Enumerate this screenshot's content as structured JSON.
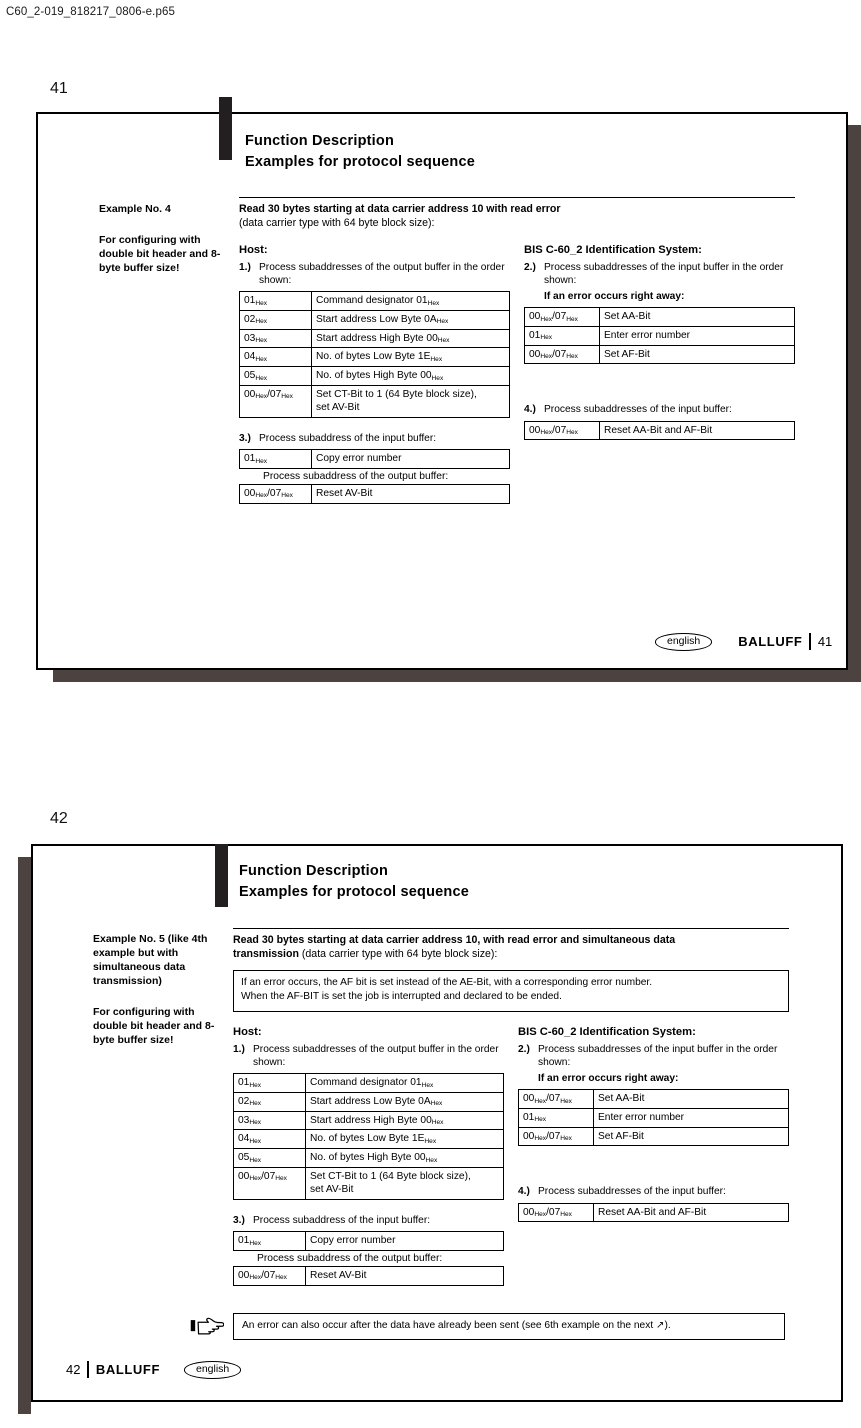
{
  "document": {
    "file_header": "C60_2-019_818217_0806-e.p65"
  },
  "common": {
    "title_line1": "Function Description",
    "title_line2": "Examples for protocol sequence",
    "host_heading": "Host:",
    "system_heading": "BIS C-60_2 Identification System:",
    "step1_no": "1.)",
    "step1_text": "Process subaddresses of the output buffer in the order shown:",
    "step2_no": "2.)",
    "step2_text": "Process subaddresses of the input buffer in the order shown:",
    "step2_sub": "If an error occurs right away:",
    "step3_no": "3.)",
    "step3_text": "Process subaddress of the input buffer:",
    "step3_sub": "Process subaddress of the output buffer:",
    "step4_no": "4.)",
    "step4_text": "Process subaddresses of the input buffer:",
    "english_label": "english",
    "brand": "BALLUFF",
    "output_buffer_table": [
      {
        "key": "01",
        "key_sub": "Hex",
        "key2": "",
        "value": "Command designator 01",
        "value_sub": "Hex",
        "value2": ""
      },
      {
        "key": "02",
        "key_sub": "Hex",
        "key2": "",
        "value": "Start address Low Byte 0A",
        "value_sub": "Hex",
        "value2": ""
      },
      {
        "key": "03",
        "key_sub": "Hex",
        "key2": "",
        "value": "Start address High Byte 00",
        "value_sub": "Hex",
        "value2": ""
      },
      {
        "key": "04",
        "key_sub": "Hex",
        "key2": "",
        "value": "No. of bytes Low Byte 1E",
        "value_sub": "Hex",
        "value2": ""
      },
      {
        "key": "05",
        "key_sub": "Hex",
        "key2": "",
        "value": "No. of bytes High Byte 00",
        "value_sub": "Hex",
        "value2": ""
      },
      {
        "key": "00",
        "key_sub": "Hex",
        "key2": "/07",
        "key_sub2": "Hex",
        "value": "Set CT-Bit to 1 (64 Byte block size),",
        "value_sub": "",
        "value2": "set AV-Bit"
      }
    ],
    "input_buffer_table": [
      {
        "key": "00",
        "key_sub": "Hex",
        "key2": "/07",
        "key_sub2": "Hex",
        "value": "Set AA-Bit"
      },
      {
        "key": "01",
        "key_sub": "Hex",
        "key2": "",
        "value": "Enter error number"
      },
      {
        "key": "00",
        "key_sub": "Hex",
        "key2": "/07",
        "key_sub2": "Hex",
        "value": "Set AF-Bit"
      }
    ],
    "step3_table1": [
      {
        "key": "01",
        "key_sub": "Hex",
        "key2": "",
        "value": "Copy error number"
      }
    ],
    "step3_table2": [
      {
        "key": "00",
        "key_sub": "Hex",
        "key2": "/07",
        "key_sub2": "Hex",
        "value": "Reset AV-Bit"
      }
    ],
    "step4_table": [
      {
        "key": "00",
        "key_sub": "Hex",
        "key2": "/07",
        "key_sub2": "Hex",
        "value": "Reset AA-Bit and AF-Bit"
      }
    ]
  },
  "page41": {
    "page_number": "41",
    "side_heads": [
      "Example No. 4",
      "For configuring with double bit header and 8-byte buffer size!"
    ],
    "lede_bold": "Read 30 bytes starting at data carrier address 10 with read error",
    "lede_plain": "(data carrier type with 64 byte block size):"
  },
  "page42": {
    "page_number": "42",
    "side_heads": [
      "Example No. 5 (like 4th example but with simultaneous data transmission)",
      "For configuring with double bit header and 8-byte buffer size!"
    ],
    "lede_bold1": "Read 30 bytes starting at data carrier address 10, with read error and simultaneous data",
    "lede_bold2": "transmission",
    "lede_plain": " (data carrier type with 64 byte block size):",
    "info_box_line1": "If an error occurs, the AF bit is set instead of the AE-Bit, with a corresponding error number.",
    "info_box_line2": "When the AF-BIT is set the job is interrupted and declared to be ended.",
    "note_text": "An error can also occur after the data have already been sent (see 6th example on the next ↗)."
  }
}
